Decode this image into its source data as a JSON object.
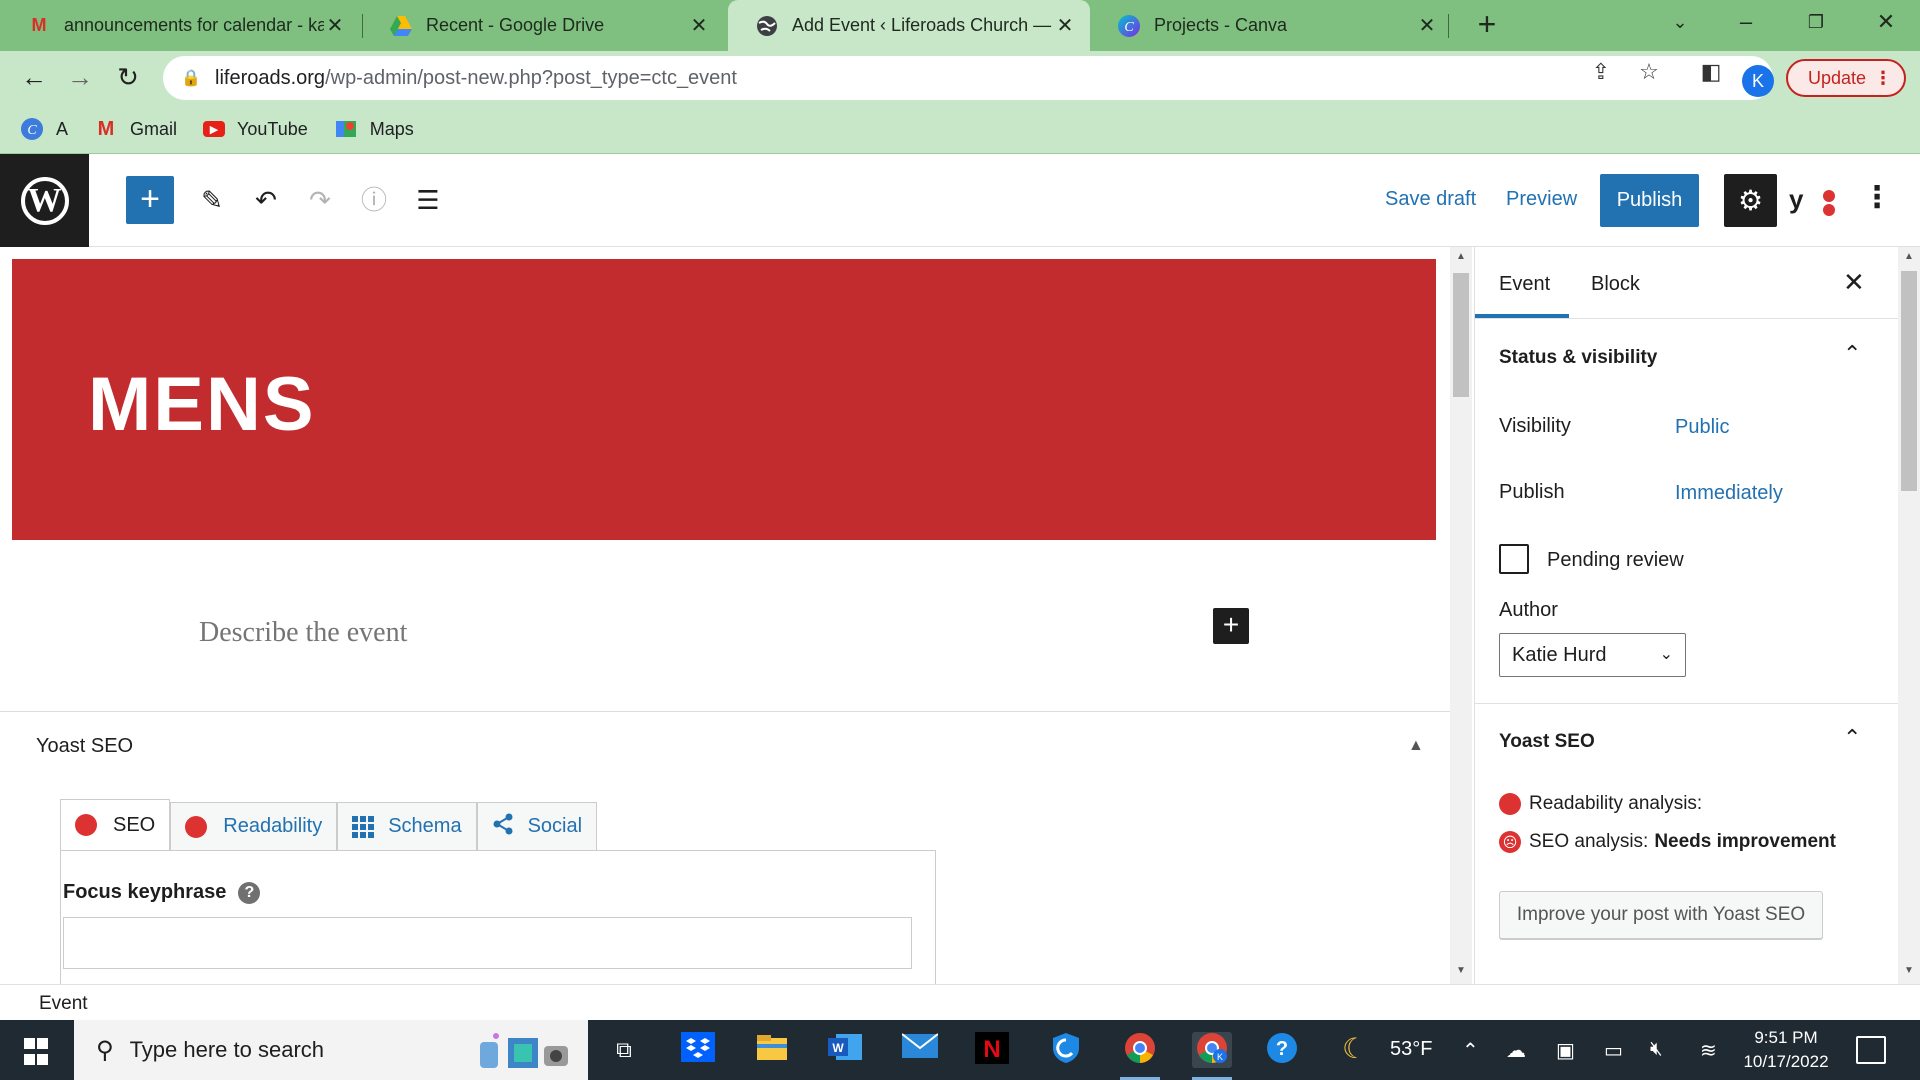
{
  "browser": {
    "tabs": [
      {
        "title": "announcements for calendar - ka",
        "favicon": "gmail-icon"
      },
      {
        "title": "Recent - Google Drive",
        "favicon": "google-drive-icon"
      },
      {
        "title": "Add Event ‹ Liferoads Church — ",
        "favicon": "globe-icon"
      },
      {
        "title": "Projects - Canva",
        "favicon": "canva-icon"
      }
    ],
    "url_host": "liferoads.org",
    "url_path": "/wp-admin/post-new.php?post_type=ctc_event",
    "profile_initial": "K",
    "update_label": "Update",
    "bookmarks": [
      {
        "label": "A",
        "icon": "canva-icon"
      },
      {
        "label": "Gmail",
        "icon": "gmail-icon"
      },
      {
        "label": "YouTube",
        "icon": "youtube-icon"
      },
      {
        "label": "Maps",
        "icon": "maps-icon"
      }
    ]
  },
  "editor_header": {
    "save_draft": "Save draft",
    "preview": "Preview",
    "publish": "Publish"
  },
  "content": {
    "cover_title": "MENS",
    "placeholder": "Describe the event",
    "yoast_title": "Yoast SEO",
    "yoast_tabs": {
      "seo": "SEO",
      "readability": "Readability",
      "schema": "Schema",
      "social": "Social"
    },
    "focus_keyphrase": "Focus keyphrase"
  },
  "sidebar": {
    "tab_event": "Event",
    "tab_block": "Block",
    "status_title": "Status & visibility",
    "visibility_label": "Visibility",
    "visibility_value": "Public",
    "publish_label": "Publish",
    "publish_value": "Immediately",
    "pending_review": "Pending review",
    "author_label": "Author",
    "author_value": "Katie Hurd",
    "yoast_title": "Yoast SEO",
    "readability_analysis": "Readability analysis:",
    "seo_analysis": "SEO analysis:",
    "seo_status": "Needs improvement",
    "improve_button": "Improve your post with Yoast SEO"
  },
  "breadcrumb": "Event",
  "taskbar": {
    "search_placeholder": "Type here to search",
    "temperature": "53°F",
    "time": "9:51 PM",
    "date": "10/17/2022"
  },
  "colors": {
    "wp_blue": "#2271b1",
    "cover_red": "#c22c2f",
    "yoast_red": "#dc3232",
    "chrome_green": "#7fbf7f"
  }
}
